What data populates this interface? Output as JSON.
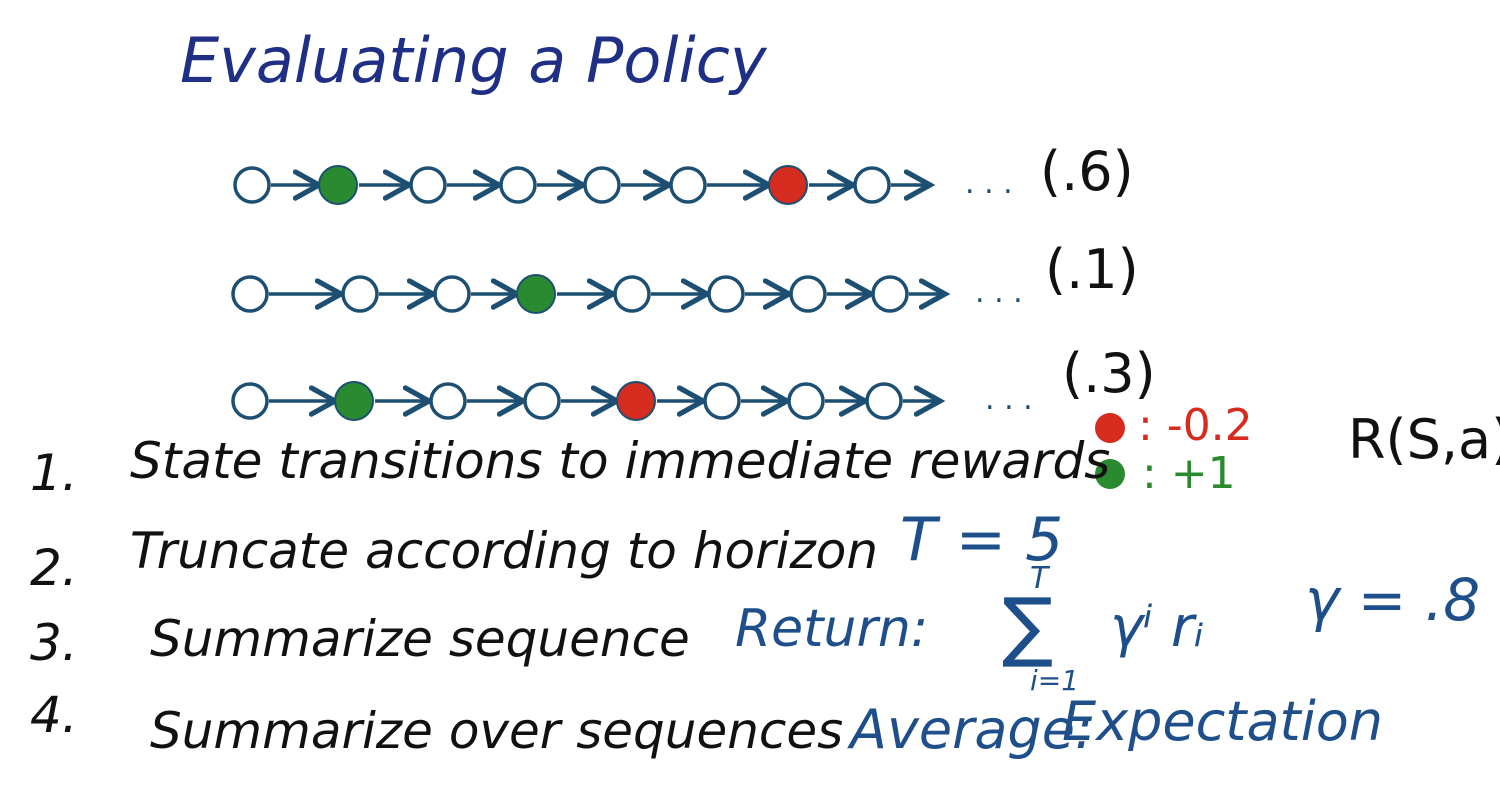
{
  "title": "Evaluating a Policy",
  "colors": {
    "title_ink": "#1f2f86",
    "chain_ink": "#1d4f73",
    "reward_negative": "#d62b1f",
    "reward_positive": "#2a8a2f",
    "text_ink": "#111111",
    "note_ink": "#1f4f8a"
  },
  "sequences": [
    {
      "probability": "(.6)",
      "states": [
        "empty",
        "green",
        "empty",
        "empty",
        "empty",
        "empty",
        "red",
        "empty"
      ]
    },
    {
      "probability": "(.1)",
      "states": [
        "empty",
        "empty",
        "empty",
        "green",
        "empty",
        "empty",
        "empty",
        "empty"
      ]
    },
    {
      "probability": "(.3)",
      "states": [
        "empty",
        "green",
        "empty",
        "empty",
        "red",
        "empty",
        "empty",
        "empty"
      ]
    }
  ],
  "ellipsis": ". . .",
  "legend": {
    "red_value": ": -0.2",
    "green_value": ": +1",
    "reward_fn": "R(S,a)"
  },
  "steps": [
    {
      "number": "1.",
      "text": "State transitions to immediate rewards"
    },
    {
      "number": "2.",
      "text": "Truncate according to horizon"
    },
    {
      "number": "3.",
      "text": "Summarize sequence"
    },
    {
      "number": "4.",
      "text": "Summarize over sequences"
    }
  ],
  "notes": {
    "horizon": "T = 5",
    "return_label": "Return:",
    "sum_upper": "T",
    "sum_lower": "i=1",
    "sum_sign": "∑",
    "sum_term": "γⁱ rᵢ",
    "gamma": "γ = .8",
    "average_label": "Average:",
    "expectation": "Expectation"
  }
}
